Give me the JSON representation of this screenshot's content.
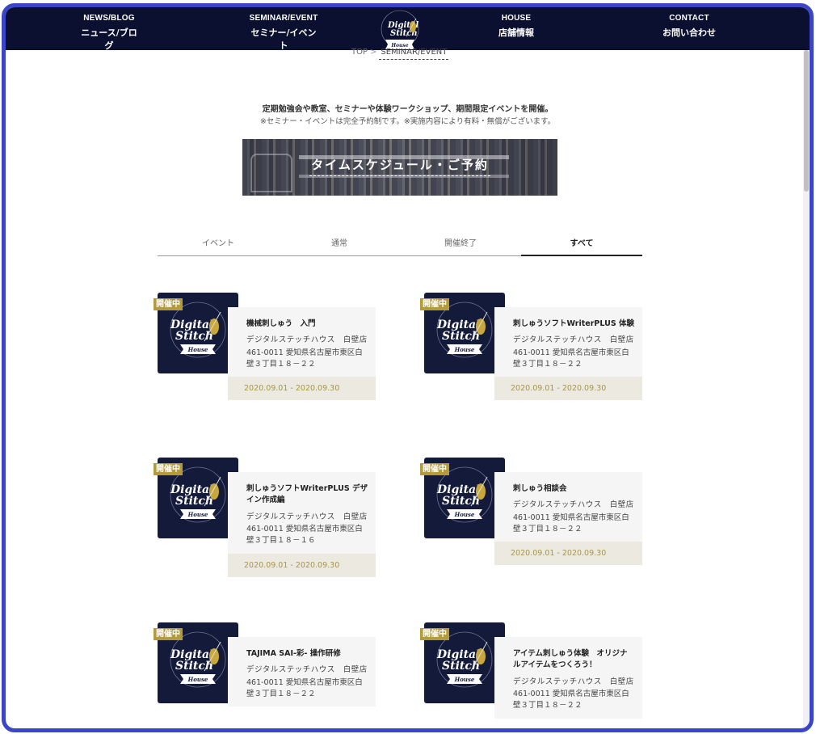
{
  "nav": {
    "items": [
      {
        "en": "NEWS/BLOG",
        "ja": "ニュース/ブログ"
      },
      {
        "en": "SEMINAR/EVENT",
        "ja": "セミナー/イベント"
      },
      {
        "en": "HOUSE",
        "ja": "店舗情報"
      },
      {
        "en": "CONTACT",
        "ja": "お問い合わせ"
      }
    ],
    "logo": {
      "line1": "Digital",
      "line2": "Stitch",
      "ribbon": "House",
      "arc": "BORN & CRAFT WITH US"
    }
  },
  "breadcrumb": {
    "home": "TOP",
    "sep": ">",
    "current": "SEMINAR/EVENT"
  },
  "intro": {
    "line1": "定期勉強会や教室、セミナーや体験ワークショップ、期間限定イベントを開催。",
    "line2": "※セミナー・イベントは完全予約制です。※実施内容により有料・無償がございます。"
  },
  "banner": {
    "title": "タイムスケジュール・ご予約"
  },
  "tabs": [
    {
      "label": "イベント",
      "active": false
    },
    {
      "label": "通常",
      "active": false
    },
    {
      "label": "開催終了",
      "active": false
    },
    {
      "label": "すべて",
      "active": true
    }
  ],
  "cards": [
    {
      "badge": "開催中",
      "title": "機械刺しゅう　入門",
      "shop": "デジタルステッチハウス　白壁店",
      "addr": "461-0011 愛知県名古屋市東区白壁３丁目１８－２２",
      "date": "2020.09.01 - 2020.09.30"
    },
    {
      "badge": "開催中",
      "title": "刺しゅうソフトWriterPLUS 体験",
      "shop": "デジタルステッチハウス　白壁店",
      "addr": "461-0011 愛知県名古屋市東区白壁３丁目１８－２２",
      "date": "2020.09.01 - 2020.09.30"
    },
    {
      "badge": "開催中",
      "title": "刺しゅうソフトWriterPLUS デザイン作成編",
      "shop": "デジタルステッチハウス　白壁店",
      "addr": "461-0011 愛知県名古屋市東区白壁３丁目１８－１６",
      "date": "2020.09.01 - 2020.09.30"
    },
    {
      "badge": "開催中",
      "title": "刺しゅう相談会",
      "shop": "デジタルステッチハウス　白壁店",
      "addr": "461-0011 愛知県名古屋市東区白壁３丁目１８－２２",
      "date": "2020.09.01 - 2020.09.30"
    },
    {
      "badge": "開催中",
      "title": "TAJIMA SAI-彩- 操作研修",
      "shop": "デジタルステッチハウス　白壁店",
      "addr": "461-0011 愛知県名古屋市東区白壁３丁目１８－２２",
      "date": ""
    },
    {
      "badge": "開催中",
      "title": "アイテム刺しゅう体験　オリジナルアイテムをつくろう！",
      "shop": "デジタルステッチハウス　白壁店",
      "addr": "461-0011 愛知県名古屋市東区白壁３丁目１８－２２",
      "date": ""
    }
  ],
  "colors": {
    "nav_bg": "#0c1030",
    "thumb_bg": "#141a3a",
    "badge": "#b39b3a",
    "date_text": "#a89648",
    "frame": "#3b45c8"
  }
}
